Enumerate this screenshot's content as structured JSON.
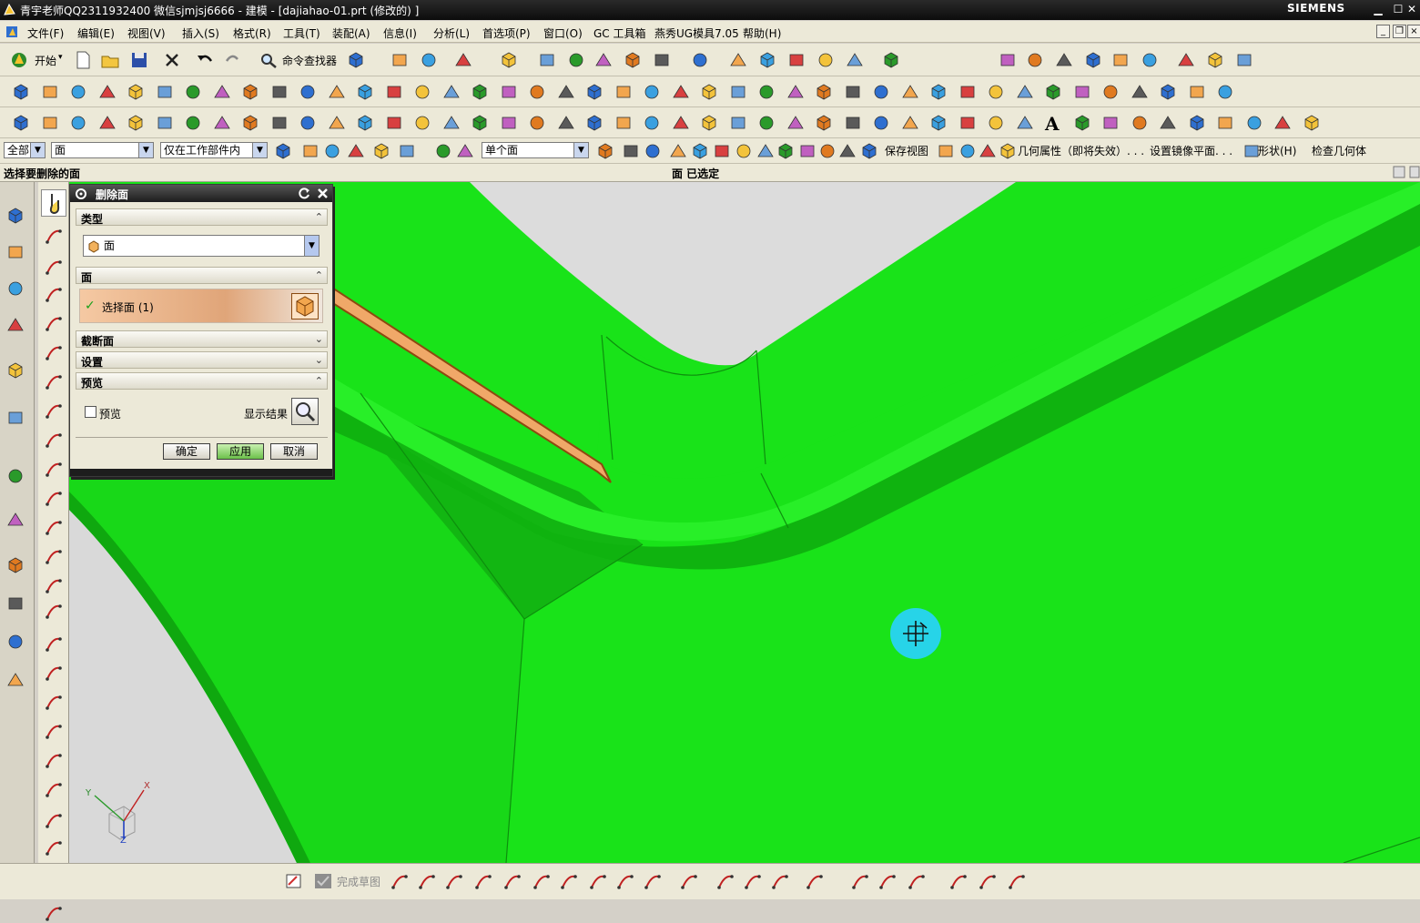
{
  "window": {
    "title": "青宇老师QQ2311932400 微信sjmjsj6666 - 建模 - [dajiahao-01.prt  (修改的) ]",
    "brand": "SIEMENS"
  },
  "menu": {
    "items": [
      "文件(F)",
      "编辑(E)",
      "视图(V)",
      "插入(S)",
      "格式(R)",
      "工具(T)",
      "装配(A)",
      "信息(I)",
      "分析(L)",
      "首选项(P)",
      "窗口(O)",
      "GC 工具箱",
      "燕秀UG模具7.05",
      "帮助(H)"
    ]
  },
  "toolbar1": {
    "start_label": "开始",
    "command_finder_label": "命令查找器"
  },
  "selection_bar": {
    "filter_value": "全部",
    "type_value": "面",
    "scope_value": "仅在工作部件内",
    "face_rule_value": "单个面",
    "save_view_label": "保存视图",
    "geom_props_label": "几何属性（即将失效）. . .",
    "mirror_plane_label": "设置镜像平面. . .",
    "shape_label": "形状(H)",
    "check_geom_label": "检查几何体"
  },
  "status": {
    "prompt": "选择要删除的面",
    "selection": "面 已选定"
  },
  "dialog": {
    "title": "删除面",
    "section_type": "类型",
    "type_value": "面",
    "section_face": "面",
    "select_face_label": "选择面 (1)",
    "section_cross": "截断面",
    "section_settings": "设置",
    "section_preview": "预览",
    "preview_checkbox_label": "预览",
    "show_result_label": "显示结果",
    "ok_label": "确定",
    "apply_label": "应用",
    "cancel_label": "取消"
  },
  "triad": {
    "x": "X",
    "y": "Y",
    "z": "Z"
  },
  "bottombar": {
    "finish_sketch_label": "完成草图"
  },
  "colors": {
    "model_green": "#19e319",
    "highlight_orange": "#f0a868",
    "cursor_cyan": "#27d4e8"
  }
}
